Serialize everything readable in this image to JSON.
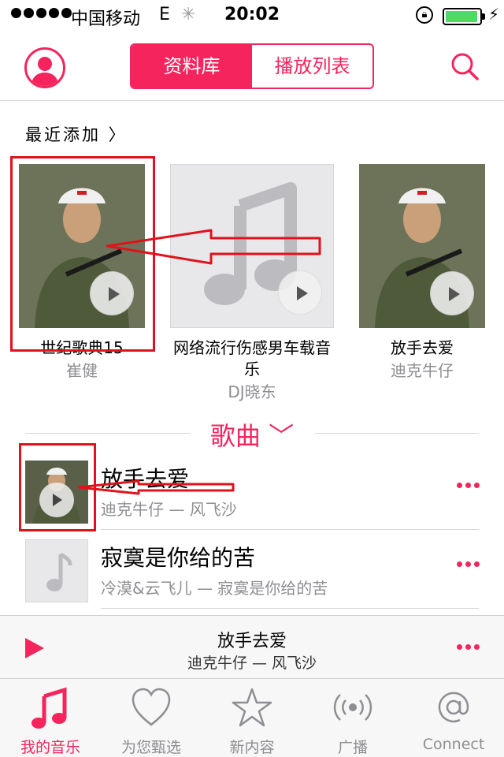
{
  "status_bar": {
    "carrier": "中国移动",
    "network": "E",
    "time": "20:02",
    "battery_fill": 0.95
  },
  "nav": {
    "segments": [
      "资料库",
      "播放列表"
    ],
    "active_segment": 0
  },
  "recently_added": {
    "title": "最近添加 〉",
    "albums": [
      {
        "title": "世纪歌典15",
        "artist": "崔健",
        "cover": "photo"
      },
      {
        "title": "网络流行伤感男车载音乐",
        "artist": "DJ晓东",
        "cover": "music-note-placeholder"
      },
      {
        "title": "放手去爱",
        "artist": "迪克牛仔",
        "cover": "photo"
      }
    ]
  },
  "songs": {
    "header": "歌曲",
    "items": [
      {
        "name": "放手去爱",
        "subtitle": "迪克牛仔 — 风飞沙",
        "thumb": "photo"
      },
      {
        "name": "寂寞是你给的苦",
        "subtitle": "冷漠&云飞儿 — 寂寞是你给的苦",
        "thumb": "music-note-placeholder"
      }
    ]
  },
  "now_playing": {
    "title": "放手去爱",
    "subtitle": "迪克牛仔 — 风飞沙"
  },
  "tabs": [
    {
      "label": "我的音乐",
      "icon": "music-note-icon",
      "active": true
    },
    {
      "label": "为您甄选",
      "icon": "heart-icon",
      "active": false
    },
    {
      "label": "新内容",
      "icon": "star-icon",
      "active": false
    },
    {
      "label": "广播",
      "icon": "radio-broadcast-icon",
      "active": false
    },
    {
      "label": "Connect",
      "icon": "at-sign-icon",
      "active": false
    }
  ],
  "colors": {
    "accent": "#f5245d",
    "annotation": "#e0121b",
    "secondary_text": "#8e8e93"
  }
}
